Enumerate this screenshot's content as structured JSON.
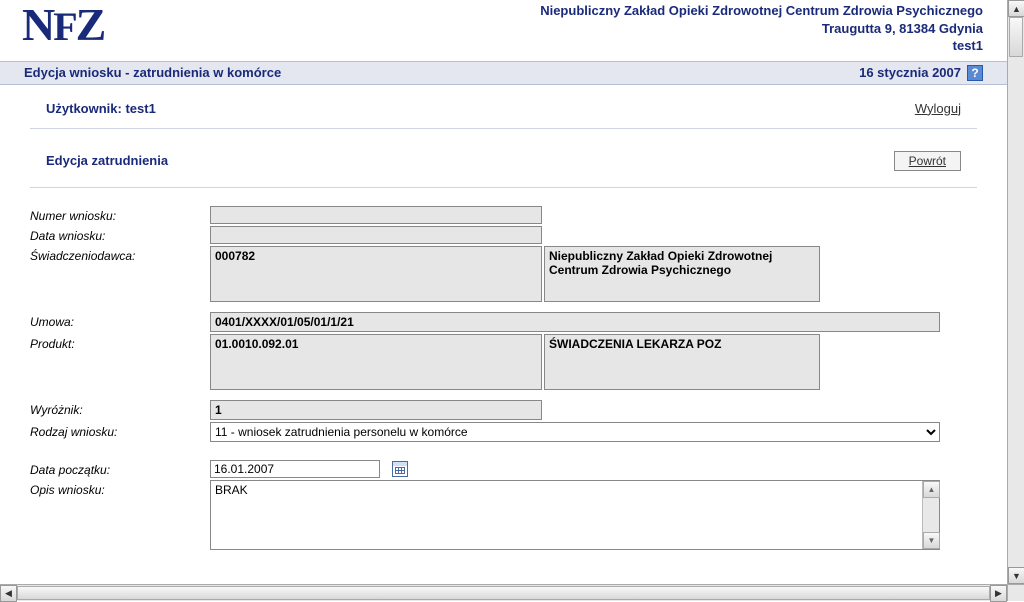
{
  "header": {
    "org_name": "Niepubliczny Zakład Opieki Zdrowotnej Centrum Zdrowia Psychicznego",
    "address": "Traugutta 9, 81384 Gdynia",
    "user": "test1"
  },
  "titlebar": {
    "title": "Edycja wniosku - zatrudnienia w komórce",
    "date": "16 stycznia 2007"
  },
  "userbar": {
    "user_label": "Użytkownik: test1",
    "logout": "Wyloguj"
  },
  "section": {
    "heading": "Edycja zatrudnienia",
    "return_btn": "Powrót"
  },
  "form": {
    "numer_wniosku": {
      "label": "Numer wniosku:",
      "value": ""
    },
    "data_wniosku": {
      "label": "Data wniosku:",
      "value": ""
    },
    "swiadczeniodawca": {
      "label": "Świadczeniodawca:",
      "code": "000782",
      "name": "Niepubliczny Zakład Opieki Zdrowotnej Centrum Zdrowia Psychicznego"
    },
    "umowa": {
      "label": "Umowa:",
      "value": "0401/XXXX/01/05/01/1/21"
    },
    "produkt": {
      "label": "Produkt:",
      "code": "01.0010.092.01",
      "name": "ŚWIADCZENIA LEKARZA POZ"
    },
    "wyroznik": {
      "label": "Wyróżnik:",
      "value": "1"
    },
    "rodzaj_wniosku": {
      "label": "Rodzaj wniosku:",
      "selected": "11 - wniosek zatrudnienia personelu w komórce"
    },
    "data_poczatku": {
      "label": "Data początku:",
      "value": "16.01.2007"
    },
    "opis_wniosku": {
      "label": "Opis wniosku:",
      "value": "BRAK"
    }
  }
}
